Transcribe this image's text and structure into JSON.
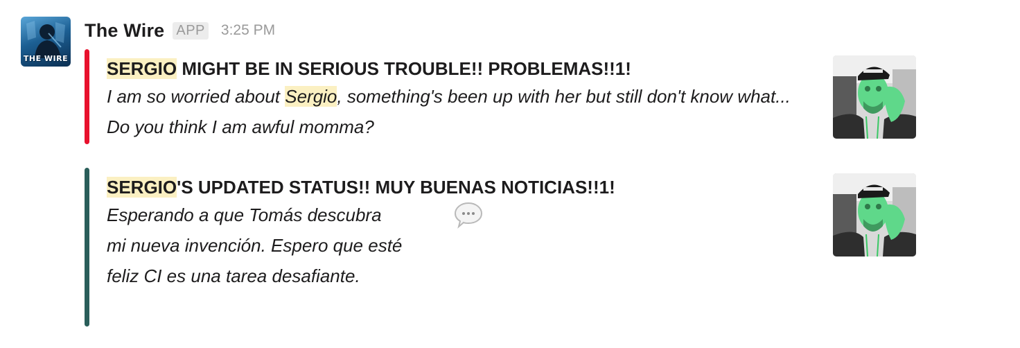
{
  "sender": {
    "name": "The Wire",
    "badge": "APP",
    "timestamp": "3:25 PM",
    "avatar_label": "THE WIRE"
  },
  "attachments": [
    {
      "color": "#e8112d",
      "title_highlight": "SERGIO",
      "title_rest": " MIGHT BE IN SERIOUS TROUBLE!! PROBLEMAS!!1!",
      "text_before": "I am so worried about ",
      "text_highlight": "Sergio",
      "text_after": ", something's been up with her but still don't know what... Do you think I am awful momma?",
      "thumbnail_icon": "person-photo-thumbnail"
    },
    {
      "color": "#2a5e5a",
      "title_highlight": "SERGIO",
      "title_rest": "'S UPDATED STATUS!! MUY BUENAS NOTICIAS!!1!",
      "text": "Esperando a que Tomás descubra mi nueva invención. Espero que esté feliz CI es una tarea desafiante.",
      "emoji_icon": "speech-balloon-icon",
      "thumbnail_icon": "person-photo-thumbnail"
    }
  ]
}
